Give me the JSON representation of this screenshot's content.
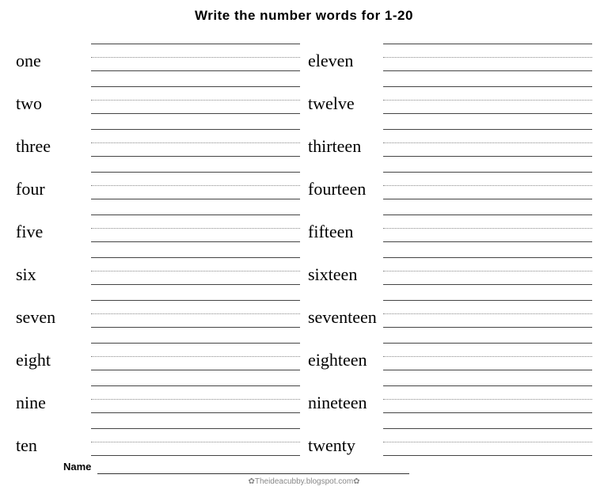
{
  "title": "Write the number words for  1-20",
  "left_words": [
    "one",
    "two",
    "three",
    "four",
    "five",
    "six",
    "seven",
    "eight",
    "nine",
    "ten"
  ],
  "right_words": [
    "eleven",
    "twelve",
    "thirteen",
    "fourteen",
    "fifteen",
    "sixteen",
    "seventeen",
    "eighteen",
    "nineteen",
    "twenty"
  ],
  "footer": {
    "name_label": "Name",
    "attribution": "✿Theideacubby.blogspot.com✿"
  }
}
